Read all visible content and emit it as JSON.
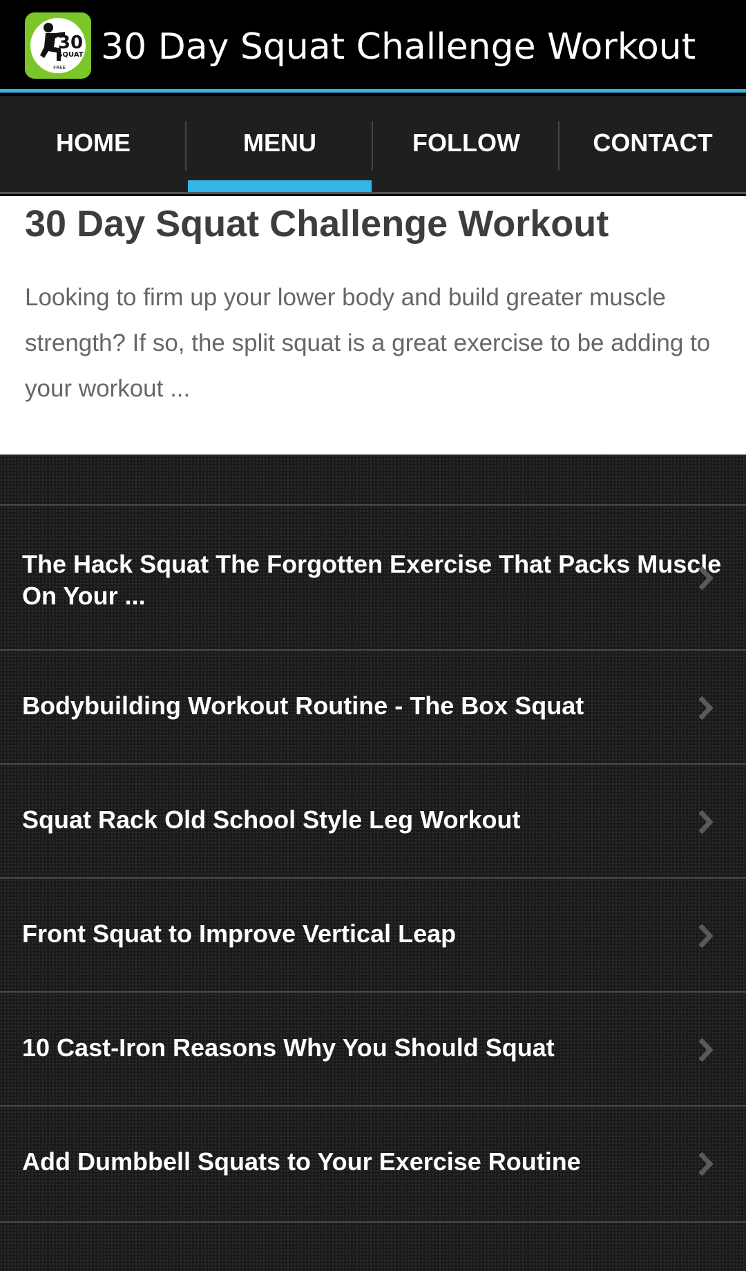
{
  "app": {
    "title": "30 Day Squat Challenge Workout",
    "icon": "squat-logo-icon",
    "icon_text_number": "30",
    "icon_text_word": "SQUAT",
    "icon_text_free": "FREE"
  },
  "nav": {
    "tabs": [
      {
        "label": "HOME",
        "active": false
      },
      {
        "label": "MENU",
        "active": true
      },
      {
        "label": "FOLLOW",
        "active": false
      },
      {
        "label": "CONTACT",
        "active": false
      }
    ]
  },
  "intro": {
    "title": "30 Day Squat Challenge Workout",
    "text": "Looking to firm up your lower body and build greater muscle strength? If so, the split squat is a great exercise to be adding to your workout ..."
  },
  "articles": [
    {
      "title": "The Hack Squat The Forgotten Exercise That Packs Muscle On Your ..."
    },
    {
      "title": "Bodybuilding Workout Routine - The Box Squat"
    },
    {
      "title": "Squat Rack Old School Style Leg Workout"
    },
    {
      "title": "Front Squat to Improve Vertical Leap"
    },
    {
      "title": "10 Cast-Iron Reasons Why You Should Squat"
    },
    {
      "title": "Add Dumbbell Squats to Your Exercise Routine"
    }
  ],
  "colors": {
    "accent": "#33b5e5",
    "icon_green": "#7cc62a"
  }
}
